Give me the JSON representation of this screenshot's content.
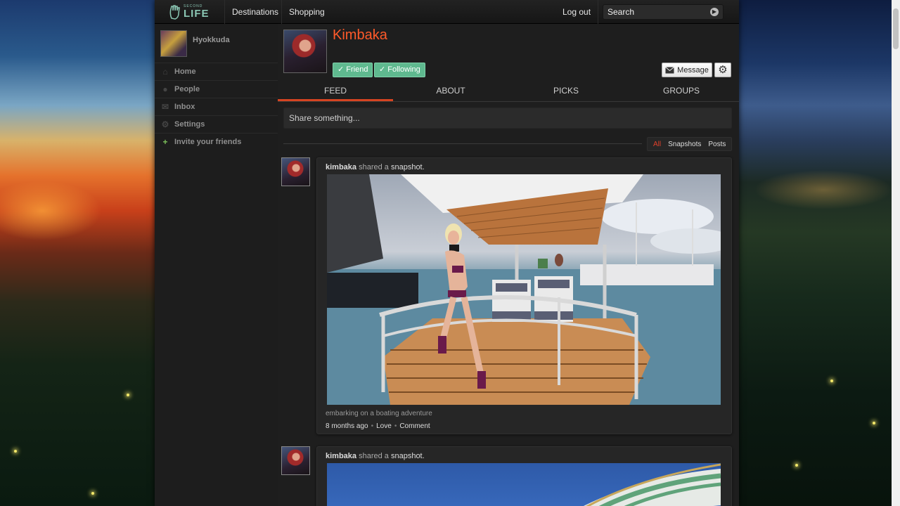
{
  "header": {
    "logo_small": "SECOND",
    "logo_big": "LIFE",
    "nav": [
      "Destinations",
      "Shopping"
    ],
    "logout": "Log out",
    "search_placeholder": "Search"
  },
  "sidebar": {
    "user_name": "Hyokkuda",
    "items": [
      {
        "label": "Home",
        "icon": "home-icon"
      },
      {
        "label": "People",
        "icon": "person-icon"
      },
      {
        "label": "Inbox",
        "icon": "envelope-icon"
      },
      {
        "label": "Settings",
        "icon": "gear-icon"
      },
      {
        "label": "Invite your friends",
        "icon": "plus-icon"
      }
    ]
  },
  "profile": {
    "name": "Kimbaka",
    "friend_label": "Friend",
    "following_label": "Following",
    "message_label": "Message"
  },
  "tabs": [
    "FEED",
    "ABOUT",
    "PICKS",
    "GROUPS"
  ],
  "share_placeholder": "Share something...",
  "filters": [
    "All",
    "Snapshots",
    "Posts"
  ],
  "posts": [
    {
      "author": "kimbaka",
      "action": "shared a",
      "object": "snapshot.",
      "caption": "embarking on a boating adventure",
      "time": "8 months ago",
      "love": "Love",
      "comment": "Comment"
    },
    {
      "author": "kimbaka",
      "action": "shared a",
      "object": "snapshot."
    }
  ],
  "colors": {
    "accent": "#ff5a2a",
    "tab_underline": "#d64421",
    "pill_green": "#5fb98f",
    "logo_teal": "#8bc7b4"
  }
}
